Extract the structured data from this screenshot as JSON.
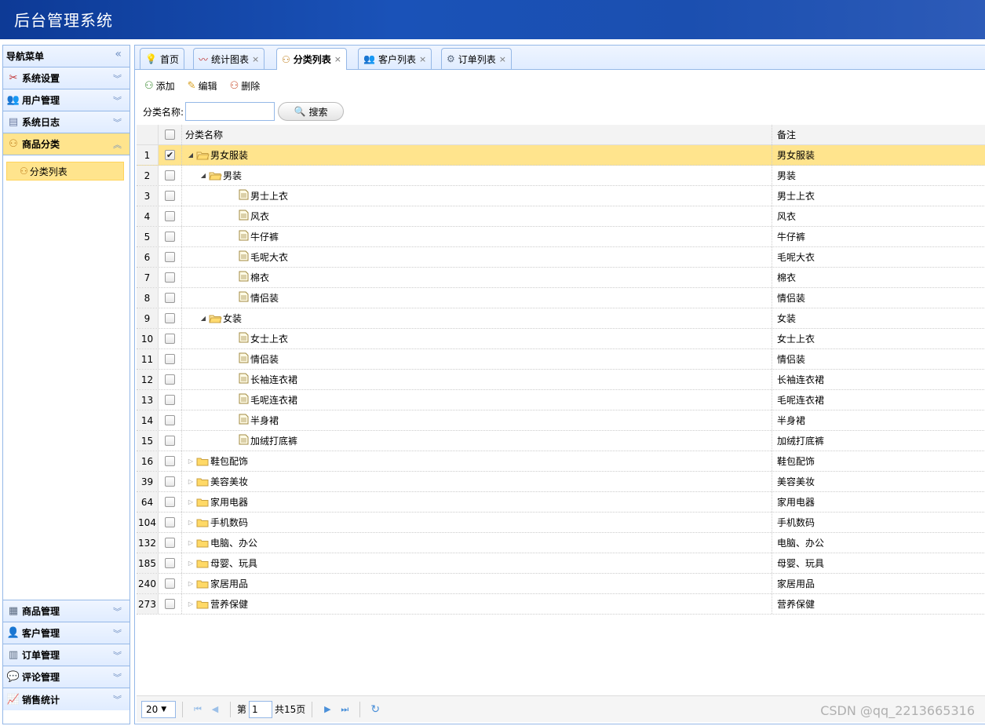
{
  "app": {
    "title": "后台管理系统"
  },
  "sidebar": {
    "header": "导航菜单",
    "sections": [
      {
        "label": "系统设置",
        "icon": "tools-icon"
      },
      {
        "label": "用户管理",
        "icon": "users-icon"
      },
      {
        "label": "系统日志",
        "icon": "log-icon"
      },
      {
        "label": "商品分类",
        "icon": "category-icon",
        "active": true
      }
    ],
    "active_item": "分类列表",
    "bottom_sections": [
      {
        "label": "商品管理",
        "icon": "goods-icon"
      },
      {
        "label": "客户管理",
        "icon": "customer-icon"
      },
      {
        "label": "订单管理",
        "icon": "order-icon"
      },
      {
        "label": "评论管理",
        "icon": "comment-icon"
      },
      {
        "label": "销售统计",
        "icon": "chart-icon"
      }
    ]
  },
  "tabs": [
    {
      "label": "首页",
      "closable": false
    },
    {
      "label": "统计图表",
      "closable": true
    },
    {
      "label": "分类列表",
      "closable": true,
      "active": true
    },
    {
      "label": "客户列表",
      "closable": true
    },
    {
      "label": "订单列表",
      "closable": true
    }
  ],
  "toolbar": {
    "add": "添加",
    "edit": "编辑",
    "delete": "删除"
  },
  "search": {
    "label": "分类名称:",
    "value": "",
    "button": "搜索"
  },
  "grid": {
    "columns": {
      "name": "分类名称",
      "note": "备注"
    },
    "rows": [
      {
        "num": "1",
        "name": "男女服装",
        "note": "男女服装",
        "level": 0,
        "kind": "open",
        "checked": true
      },
      {
        "num": "2",
        "name": "男装",
        "note": "男装",
        "level": 1,
        "kind": "open",
        "checked": false
      },
      {
        "num": "3",
        "name": "男士上衣",
        "note": "男士上衣",
        "level": 2,
        "kind": "leaf",
        "checked": false
      },
      {
        "num": "4",
        "name": "风衣",
        "note": "风衣",
        "level": 2,
        "kind": "leaf",
        "checked": false
      },
      {
        "num": "5",
        "name": "牛仔裤",
        "note": "牛仔裤",
        "level": 2,
        "kind": "leaf",
        "checked": false
      },
      {
        "num": "6",
        "name": "毛呢大衣",
        "note": "毛呢大衣",
        "level": 2,
        "kind": "leaf",
        "checked": false
      },
      {
        "num": "7",
        "name": "棉衣",
        "note": "棉衣",
        "level": 2,
        "kind": "leaf",
        "checked": false
      },
      {
        "num": "8",
        "name": "情侣装",
        "note": "情侣装",
        "level": 2,
        "kind": "leaf",
        "checked": false
      },
      {
        "num": "9",
        "name": "女装",
        "note": "女装",
        "level": 1,
        "kind": "open",
        "checked": false
      },
      {
        "num": "10",
        "name": "女士上衣",
        "note": "女士上衣",
        "level": 2,
        "kind": "leaf",
        "checked": false
      },
      {
        "num": "11",
        "name": "情侣装",
        "note": "情侣装",
        "level": 2,
        "kind": "leaf",
        "checked": false
      },
      {
        "num": "12",
        "name": "长袖连衣裙",
        "note": "长袖连衣裙",
        "level": 2,
        "kind": "leaf",
        "checked": false
      },
      {
        "num": "13",
        "name": "毛呢连衣裙",
        "note": "毛呢连衣裙",
        "level": 2,
        "kind": "leaf",
        "checked": false
      },
      {
        "num": "14",
        "name": "半身裙",
        "note": "半身裙",
        "level": 2,
        "kind": "leaf",
        "checked": false
      },
      {
        "num": "15",
        "name": "加绒打底裤",
        "note": "加绒打底裤",
        "level": 2,
        "kind": "leaf",
        "checked": false
      },
      {
        "num": "16",
        "name": "鞋包配饰",
        "note": "鞋包配饰",
        "level": 0,
        "kind": "closed",
        "checked": false
      },
      {
        "num": "39",
        "name": "美容美妆",
        "note": "美容美妆",
        "level": 0,
        "kind": "closed",
        "checked": false
      },
      {
        "num": "64",
        "name": "家用电器",
        "note": "家用电器",
        "level": 0,
        "kind": "closed",
        "checked": false
      },
      {
        "num": "104",
        "name": "手机数码",
        "note": "手机数码",
        "level": 0,
        "kind": "closed",
        "checked": false
      },
      {
        "num": "132",
        "name": "电脑、办公",
        "note": "电脑、办公",
        "level": 0,
        "kind": "closed",
        "checked": false
      },
      {
        "num": "185",
        "name": "母婴、玩具",
        "note": "母婴、玩具",
        "level": 0,
        "kind": "closed",
        "checked": false
      },
      {
        "num": "240",
        "name": "家居用品",
        "note": "家居用品",
        "level": 0,
        "kind": "closed",
        "checked": false
      },
      {
        "num": "273",
        "name": "营养保健",
        "note": "营养保健",
        "level": 0,
        "kind": "closed",
        "checked": false
      }
    ]
  },
  "pager": {
    "page_size": "20",
    "page_prefix": "第",
    "page": "1",
    "total": "共15页"
  },
  "watermark": "CSDN @qq_2213665316",
  "colors": {
    "header": "#1a4fb3",
    "selected": "#ffe48d",
    "border": "#95b8e7"
  }
}
